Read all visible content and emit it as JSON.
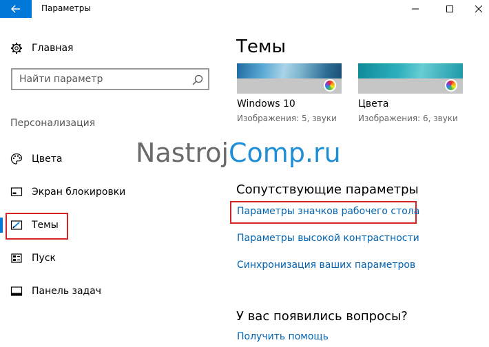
{
  "window": {
    "title": "Параметры"
  },
  "sidebar": {
    "home_label": "Главная",
    "search_placeholder": "Найти параметр",
    "section_label": "Персонализация",
    "items": [
      {
        "label": "Цвета",
        "icon": "palette-icon"
      },
      {
        "label": "Экран блокировки",
        "icon": "lock-screen-icon"
      },
      {
        "label": "Темы",
        "icon": "themes-icon",
        "active": true
      },
      {
        "label": "Пуск",
        "icon": "start-icon"
      },
      {
        "label": "Панель задач",
        "icon": "taskbar-icon"
      }
    ]
  },
  "main": {
    "title": "Темы",
    "themes": [
      {
        "name": "Windows 10",
        "meta": "Изображения: 5, звуки"
      },
      {
        "name": "Цвета",
        "meta": "Изображения: 6, звуки"
      }
    ],
    "watermark": {
      "part1": "Nastroj",
      "part2": "Comp.ru"
    },
    "related_title": "Сопутствующие параметры",
    "related_links": [
      "Параметры значков рабочего стола",
      "Параметры высокой контрастности",
      "Синхронизация ваших параметров"
    ],
    "questions_title": "У вас появились вопросы?",
    "help_link": "Получить помощь"
  },
  "colors": {
    "accent": "#0078d7",
    "link": "#0063b1",
    "highlight": "#d62424"
  }
}
